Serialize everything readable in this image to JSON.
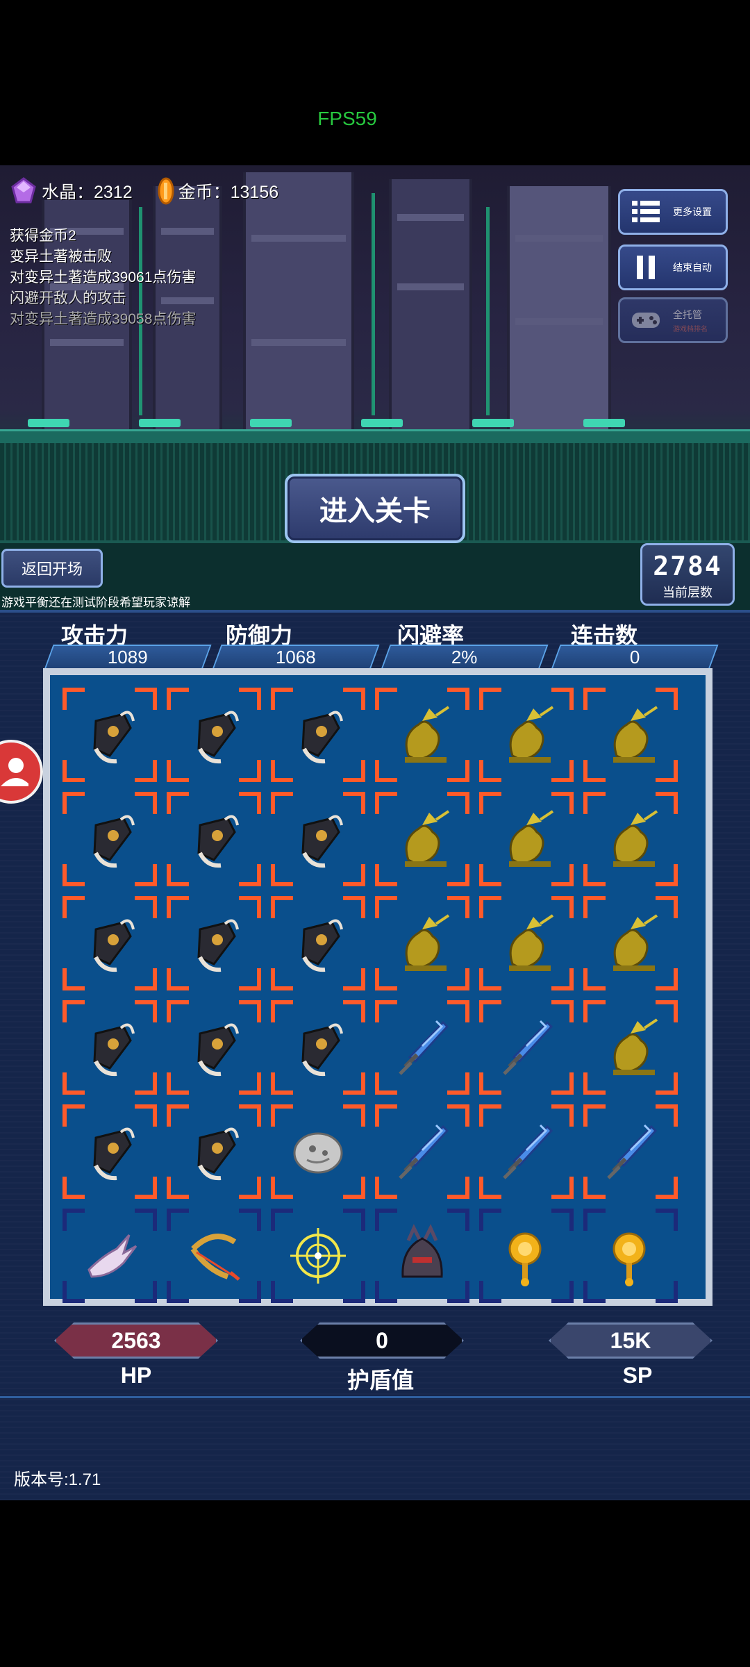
{
  "fps": "FPS59",
  "resources": {
    "crystal": "水晶：2312",
    "gold": "金币：13156"
  },
  "log": [
    "获得金币2",
    "变异土著被击败",
    "对变异土著造成39061点伤害",
    "闪避开敌人的攻击",
    "对变异土著造成39058点伤害"
  ],
  "side_buttons": {
    "more_settings": "更多设置",
    "end_auto": "结束自动",
    "auto_play": "全托管",
    "auto_play_sub": "游戏档排名"
  },
  "enter_button": "进入关卡",
  "back_button": "返回开场",
  "floor": {
    "value": "2784",
    "caption": "当前层数"
  },
  "notice": "游戏平衡还在测试阶段希望玩家谅解",
  "stats": [
    {
      "label": "攻击力",
      "value": "1089"
    },
    {
      "label": "防御力",
      "value": "1068"
    },
    {
      "label": "闪避率",
      "value": "2%"
    },
    {
      "label": "连击数",
      "value": "0"
    }
  ],
  "grid": [
    [
      "bag",
      "bag",
      "bag",
      "dragon",
      "dragon",
      "dragon"
    ],
    [
      "bag",
      "bag",
      "bag",
      "dragon",
      "dragon",
      "dragon"
    ],
    [
      "bag",
      "bag",
      "bag",
      "dragon",
      "dragon",
      "dragon"
    ],
    [
      "bag",
      "bag",
      "bag",
      "sword",
      "sword",
      "dragon"
    ],
    [
      "bag",
      "bag",
      "stone",
      "sword",
      "sword",
      "sword"
    ],
    [
      "claw",
      "bow",
      "target",
      "helmet",
      "mace",
      "mace"
    ]
  ],
  "bars": {
    "hp": {
      "value": "2563",
      "label": "HP",
      "color": "#7a3047"
    },
    "shield": {
      "value": "0",
      "label": "护盾值",
      "color": "#0a0f1f"
    },
    "sp": {
      "value": "15K",
      "label": "SP",
      "color": "#3a466c"
    }
  },
  "version": "版本号:1.71"
}
